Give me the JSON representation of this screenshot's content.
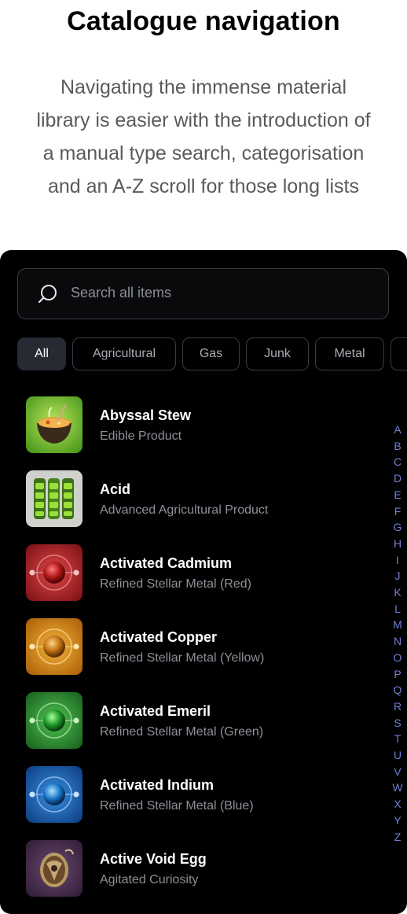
{
  "header": {
    "title": "Catalogue navigation",
    "subtitle_lines": [
      "Navigating the immense material",
      "library is easier with the introduction of",
      "a manual type search, categorisation",
      "and an A-Z scroll for those long lists"
    ]
  },
  "search": {
    "placeholder": "Search all items"
  },
  "filters": [
    "All",
    "Agricultural",
    "Gas",
    "Junk",
    "Metal"
  ],
  "active_filter": "All",
  "items": [
    {
      "title": "Abyssal Stew",
      "subtitle": "Edible Product",
      "icon": "stew-pot-icon"
    },
    {
      "title": "Acid",
      "subtitle": "Advanced Agricultural Product",
      "icon": "acid-canisters-icon"
    },
    {
      "title": "Activated Cadmium",
      "subtitle": "Refined Stellar Metal (Red)",
      "icon": "red-orb-icon"
    },
    {
      "title": "Activated Copper",
      "subtitle": "Refined Stellar Metal (Yellow)",
      "icon": "yellow-orb-icon"
    },
    {
      "title": "Activated Emeril",
      "subtitle": "Refined Stellar Metal (Green)",
      "icon": "green-orb-icon"
    },
    {
      "title": "Activated Indium",
      "subtitle": "Refined Stellar Metal (Blue)",
      "icon": "blue-orb-icon"
    },
    {
      "title": "Active Void Egg",
      "subtitle": "Agitated Curiosity",
      "icon": "void-egg-icon"
    }
  ],
  "alphabet": [
    "A",
    "B",
    "C",
    "D",
    "E",
    "F",
    "G",
    "H",
    "I",
    "J",
    "K",
    "L",
    "M",
    "N",
    "O",
    "P",
    "Q",
    "R",
    "S",
    "T",
    "U",
    "V",
    "W",
    "X",
    "Y",
    "Z"
  ],
  "colors": {
    "panel_bg": "#000000",
    "accent_letters": "#6f7fd6",
    "chip_active_bg": "#262a33",
    "red_orb": "#c0252a",
    "yellow_orb": "#e2930e",
    "green_orb": "#2aa53a",
    "blue_orb": "#1d6fc6",
    "void_egg": "#5a3a5c"
  }
}
